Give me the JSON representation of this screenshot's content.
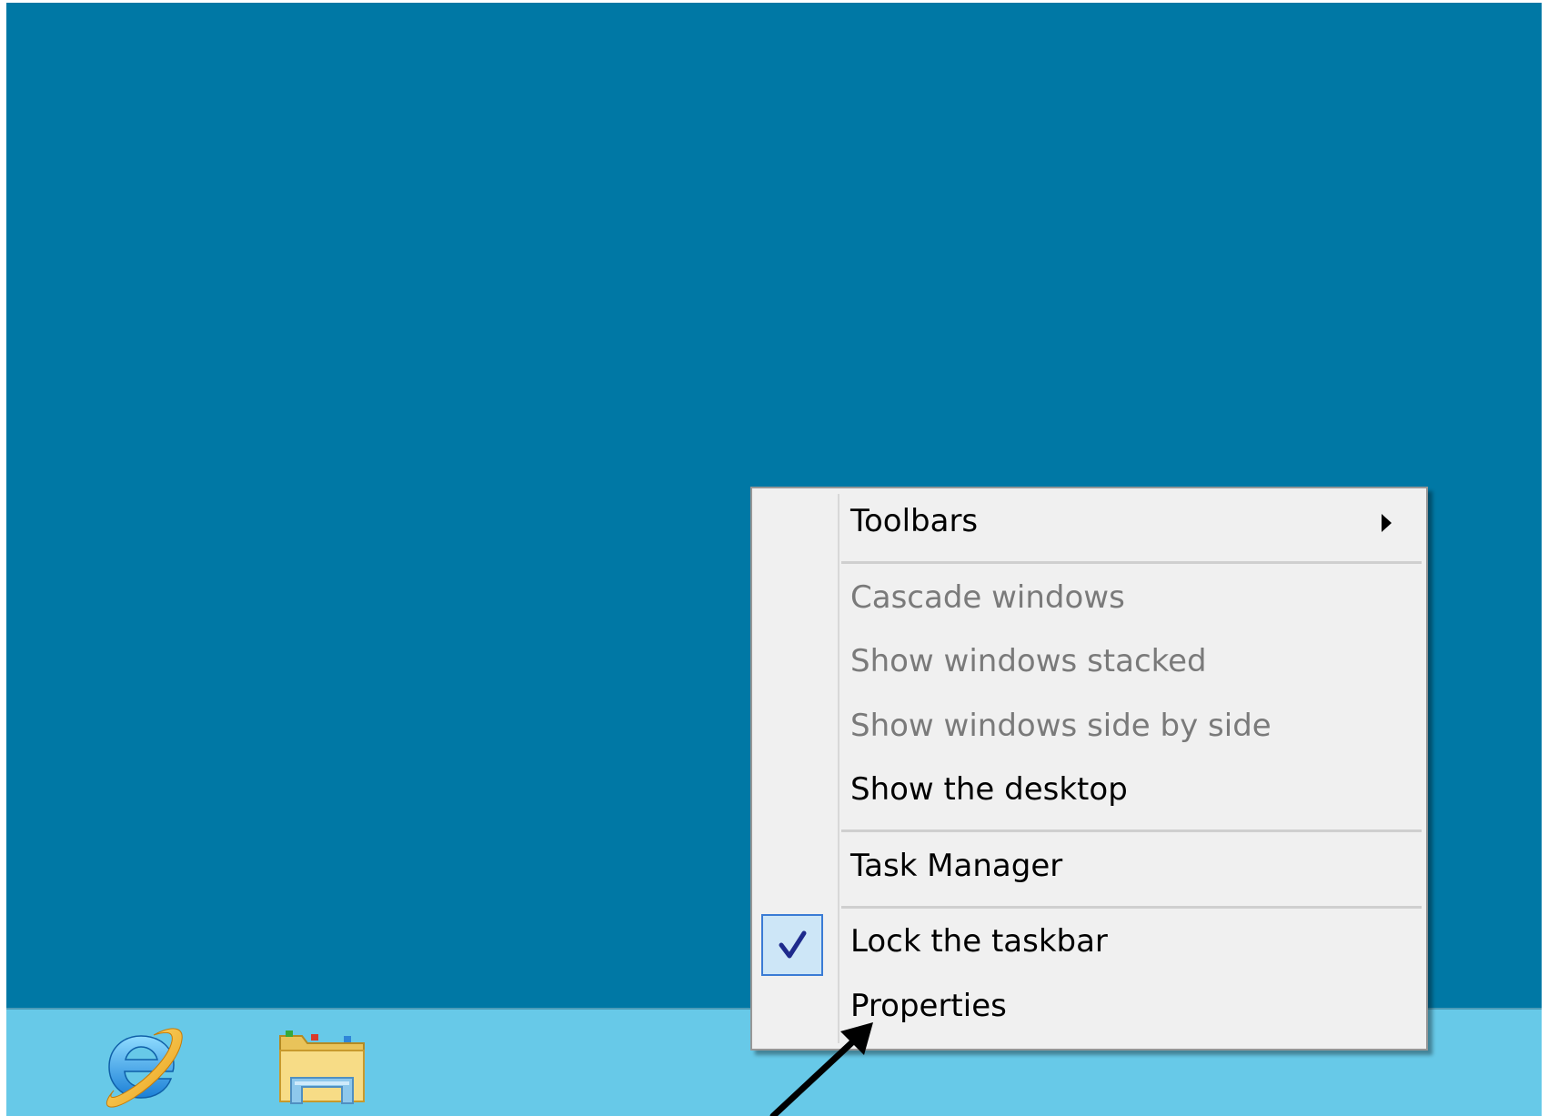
{
  "colors": {
    "desktop_bg": "#0078a5",
    "taskbar_bg": "#67c9e8",
    "menu_bg": "#f0f0f0",
    "menu_text": "#000000",
    "menu_disabled_text": "#7a7a7a",
    "check_bg": "#cde6f7",
    "check_border": "#3a7bd5",
    "check_mark": "#1e2a8c"
  },
  "taskbar": {
    "pinned": [
      {
        "name": "Internet Explorer",
        "icon": "internet-explorer-icon"
      },
      {
        "name": "File Explorer",
        "icon": "file-explorer-icon"
      }
    ]
  },
  "context_menu": {
    "items": [
      {
        "label": "Toolbars",
        "enabled": true,
        "submenu": true
      },
      {
        "label": "Cascade windows",
        "enabled": false
      },
      {
        "label": "Show windows stacked",
        "enabled": false
      },
      {
        "label": "Show windows side by side",
        "enabled": false
      },
      {
        "label": "Show the desktop",
        "enabled": true
      },
      {
        "label": "Task Manager",
        "enabled": true
      },
      {
        "label": "Lock the taskbar",
        "enabled": true,
        "checked": true
      },
      {
        "label": "Properties",
        "enabled": true
      }
    ]
  },
  "annotation": {
    "icon": "pointer-arrow-icon",
    "points_to": "Properties"
  }
}
